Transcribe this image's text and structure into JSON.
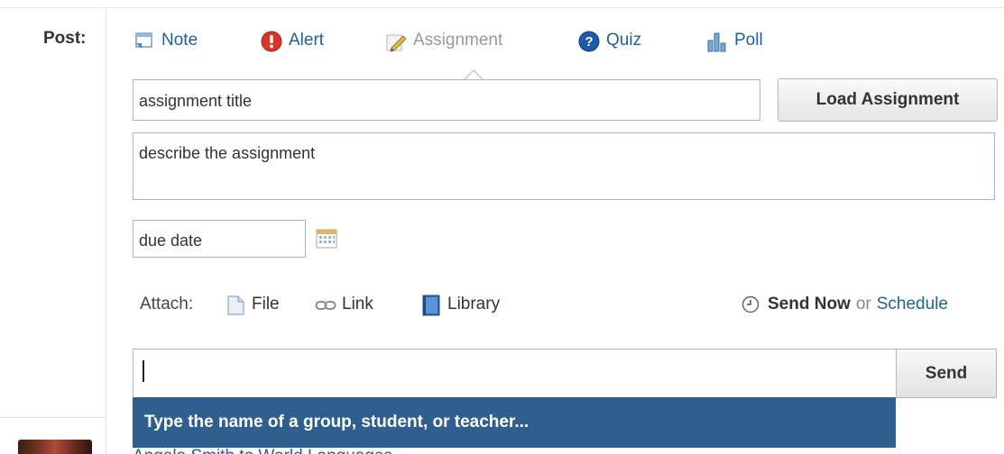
{
  "post": {
    "label": "Post:",
    "tabs": [
      {
        "label": "Note",
        "icon": "note-icon"
      },
      {
        "label": "Alert",
        "icon": "alert-icon"
      },
      {
        "label": "Assignment",
        "icon": "pencil-icon",
        "active": true
      },
      {
        "label": "Quiz",
        "icon": "question-icon"
      },
      {
        "label": "Poll",
        "icon": "poll-icon"
      }
    ]
  },
  "assignment": {
    "title_placeholder": "assignment title",
    "load_button": "Load Assignment",
    "description_placeholder": "describe the assignment",
    "due_placeholder": "due date"
  },
  "attach": {
    "label": "Attach:",
    "file": "File",
    "link": "Link",
    "library": "Library"
  },
  "send": {
    "send_now": "Send Now",
    "or": "or",
    "schedule": "Schedule",
    "recipient_value": "",
    "send_button": "Send",
    "suggestion": "Type the name of a group, student, or teacher..."
  },
  "feed": {
    "first_item_text": "Angela Smith to World Languages"
  },
  "colors": {
    "link": "#1f5f9c",
    "suggestion_bg": "#2f5f8f",
    "field_border": "#a6b8c8"
  }
}
